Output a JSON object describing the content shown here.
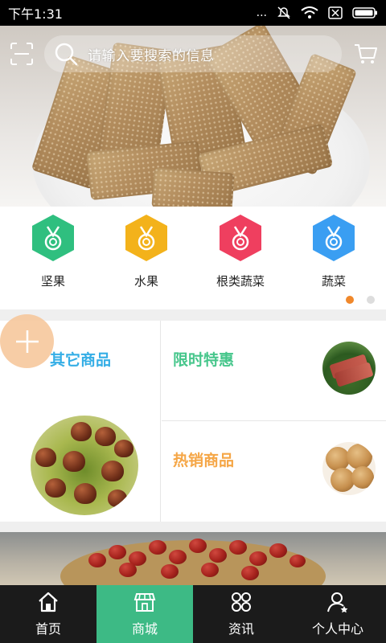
{
  "status_bar": {
    "time": "下午1:31",
    "more": "..."
  },
  "search": {
    "placeholder": "请输入要搜索的信息"
  },
  "categories": [
    {
      "label": "坚果",
      "color": "#2fbf7f"
    },
    {
      "label": "水果",
      "color": "#f3b21b"
    },
    {
      "label": "根类蔬菜",
      "color": "#ef3f5f"
    },
    {
      "label": "蔬菜",
      "color": "#3a9ef2"
    }
  ],
  "pager": {
    "page_count": 2,
    "active_index": 0,
    "active_color": "#f0882b"
  },
  "promos": {
    "other": {
      "title": "其它商品",
      "color": "#35aee6"
    },
    "limited": {
      "title": "限时特惠",
      "color": "#46c68b"
    },
    "hot": {
      "title": "热销商品",
      "color": "#f5a646"
    }
  },
  "tabbar": {
    "accent": "#3dba85",
    "items": [
      {
        "label": "首页",
        "icon": "home-icon",
        "active": false
      },
      {
        "label": "商城",
        "icon": "store-icon",
        "active": true
      },
      {
        "label": "资讯",
        "icon": "news-icon",
        "active": false
      },
      {
        "label": "个人中心",
        "icon": "user-center-icon",
        "active": false
      }
    ]
  }
}
